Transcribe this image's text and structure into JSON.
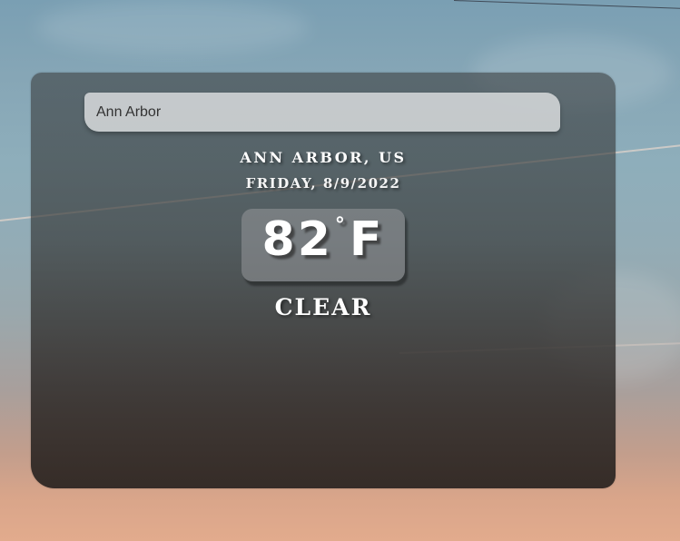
{
  "search": {
    "value": "Ann Arbor",
    "placeholder": ""
  },
  "weather": {
    "location": "ANN ARBOR, US",
    "date": "FRIDAY, 8/9/2022",
    "temperature": "82",
    "degree_symbol": "°",
    "unit": "F",
    "condition": "CLEAR"
  },
  "colors": {
    "text": "#ffffff",
    "card": "#3a3c3c",
    "search_bg": "#dddfe0"
  }
}
